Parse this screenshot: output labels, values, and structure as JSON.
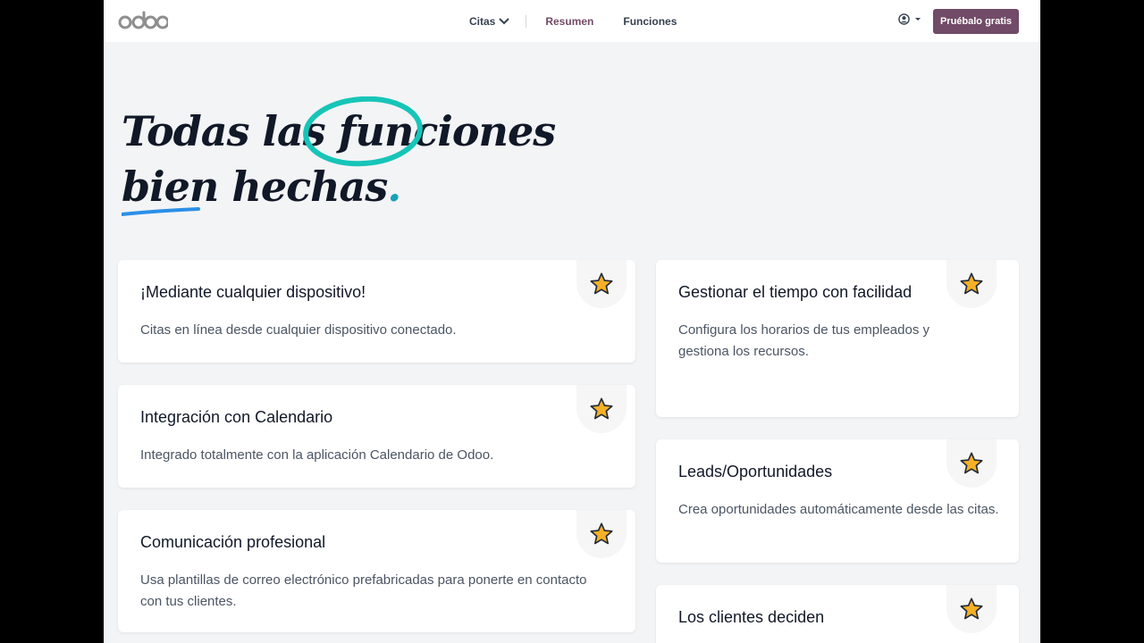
{
  "header": {
    "logo_text": "odoo",
    "nav": [
      {
        "label": "Citas"
      },
      {
        "label": "Resumen"
      },
      {
        "label": "Funciones"
      }
    ],
    "cta_label": "Pruébalo gratis",
    "brand_color": "#714b67"
  },
  "hero": {
    "line1_part1": "Todas las ",
    "line1_highlight": "funciones",
    "line2_part1": "bien",
    "line2_part2": " hechas",
    "line2_dot": "."
  },
  "cards_left": [
    {
      "title": "¡Mediante cualquier dispositivo!",
      "desc": "Citas en línea desde cualquier dispositivo conectado.",
      "icon": "star-icon"
    },
    {
      "title": "Integración con Calendario",
      "desc": "Integrado totalmente con la aplicación Calendario de Odoo.",
      "icon": "star-icon"
    },
    {
      "title": "Comunicación profesional",
      "desc": "Usa plantillas de correo electrónico prefabricadas para ponerte en contacto con tus clientes.",
      "icon": "star-icon"
    }
  ],
  "cards_right": [
    {
      "title": "Gestionar el tiempo con facilidad",
      "desc": "Configura los horarios de tus empleados y gestiona los recursos.",
      "icon": "star-icon"
    },
    {
      "title": "Leads/Oportunidades",
      "desc": "Crea oportunidades automáticamente desde las citas.",
      "icon": "star-icon"
    },
    {
      "title": "Los clientes deciden",
      "desc": "",
      "icon": "star-icon"
    }
  ]
}
